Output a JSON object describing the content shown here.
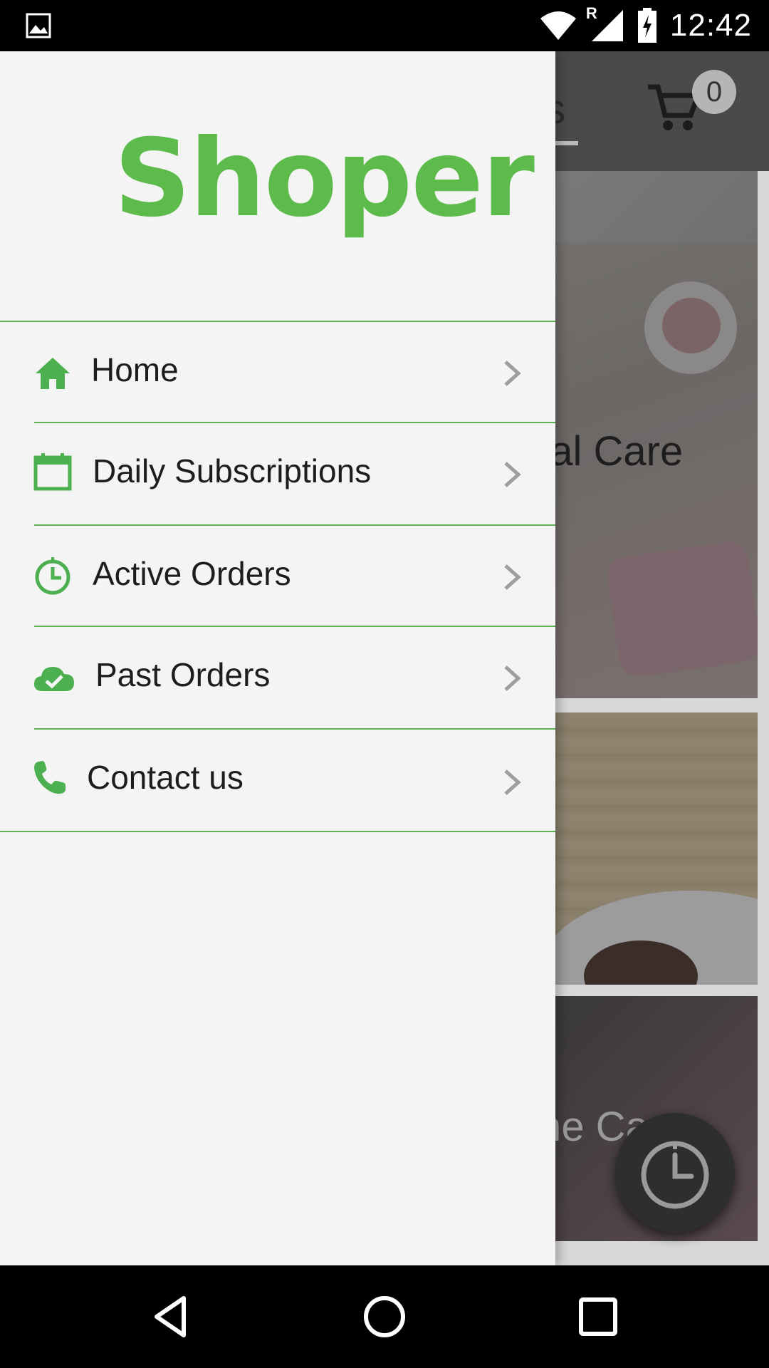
{
  "status_bar": {
    "time": "12:42",
    "icons": [
      "image-notification-icon",
      "wifi-icon",
      "signal-roaming-icon",
      "battery-charging-icon"
    ],
    "roaming_label": "R"
  },
  "background_app": {
    "tab_label_partial": "als",
    "cart_count": "0",
    "cards": [
      {
        "title_partial": "nal Care"
      },
      {
        "title_partial": ""
      },
      {
        "title_partial": "me Care"
      }
    ]
  },
  "drawer": {
    "logo_text": "Shoper",
    "accent_color": "#5cb356",
    "menu": [
      {
        "label": "Home",
        "icon": "home-icon"
      },
      {
        "label": "Daily Subscriptions",
        "icon": "calendar-icon"
      },
      {
        "label": "Active Orders",
        "icon": "clock-icon"
      },
      {
        "label": "Past Orders",
        "icon": "cloud-check-icon"
      },
      {
        "label": "Contact us",
        "icon": "phone-icon"
      }
    ]
  },
  "nav_bar": {
    "buttons": [
      "back-icon",
      "home-circle-icon",
      "recents-icon"
    ]
  }
}
